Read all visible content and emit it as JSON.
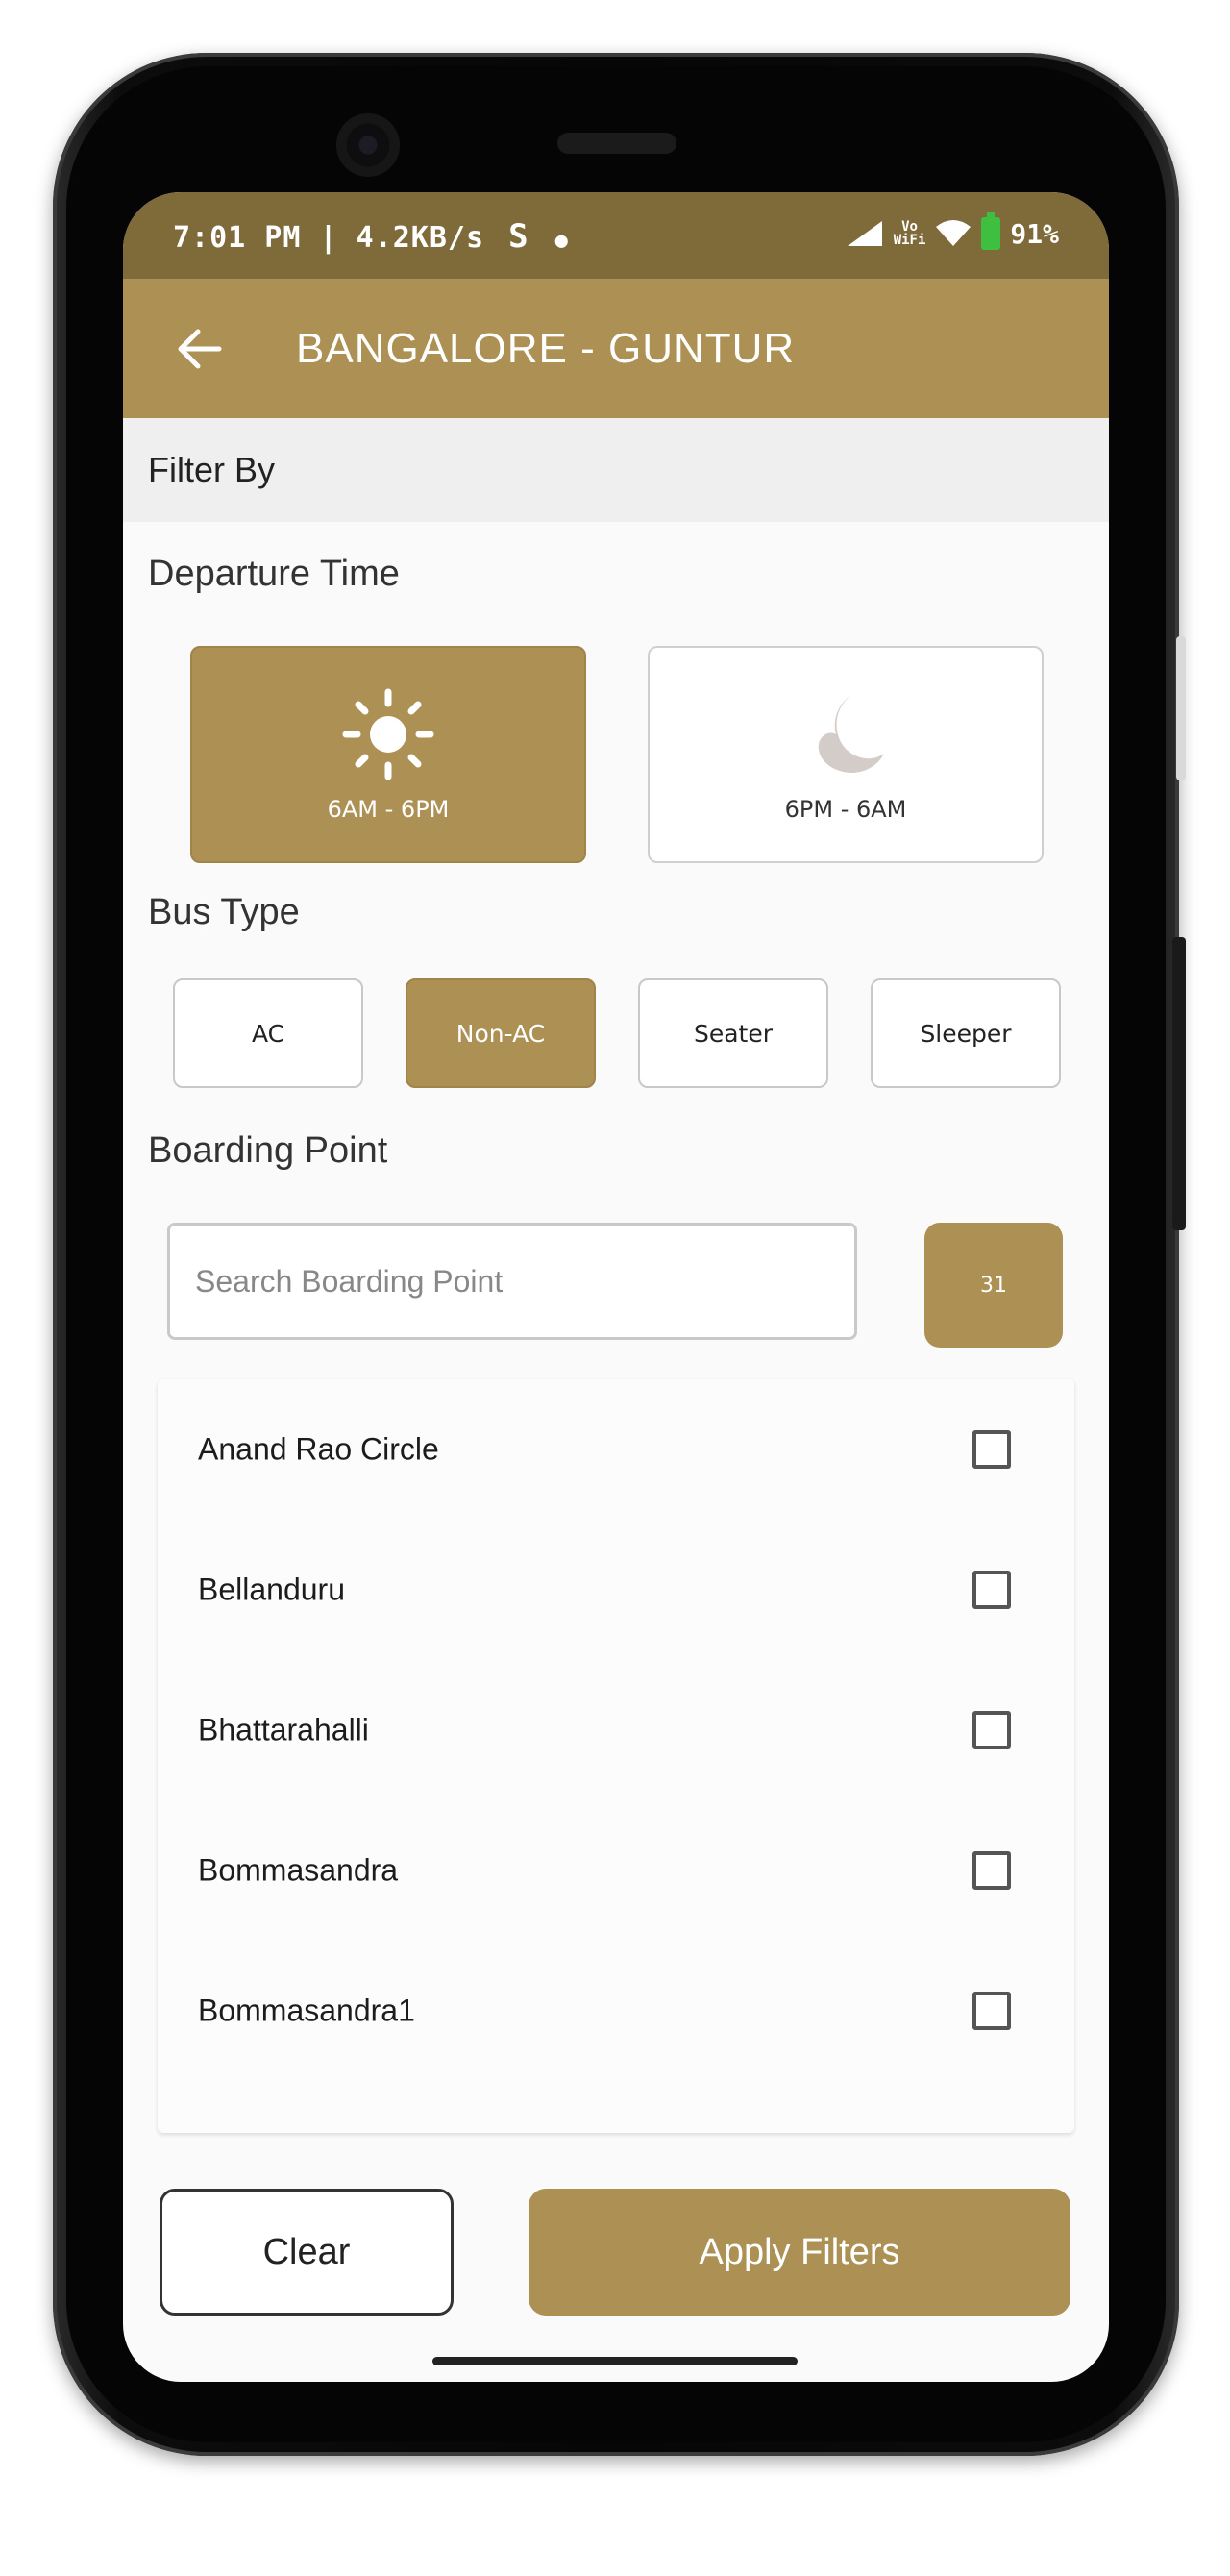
{
  "status_bar": {
    "time_speed": "7:01 PM | 4.2KB/s",
    "icons_left": [
      "s-icon",
      "notification-dot-icon"
    ],
    "vowifi": "Vo\nWiFi",
    "battery": "91%"
  },
  "app_bar": {
    "title": "BANGALORE - GUNTUR"
  },
  "filter_header": "Filter By",
  "departure": {
    "title": "Departure Time",
    "options": [
      {
        "label": "6AM - 6PM",
        "icon": "sun-icon",
        "selected": true
      },
      {
        "label": "6PM - 6AM",
        "icon": "moon-icon",
        "selected": false
      }
    ]
  },
  "bus_type": {
    "title": "Bus Type",
    "options": [
      {
        "label": "AC",
        "selected": false
      },
      {
        "label": "Non-AC",
        "selected": true
      },
      {
        "label": "Seater",
        "selected": false
      },
      {
        "label": "Sleeper",
        "selected": false
      }
    ]
  },
  "boarding": {
    "title": "Boarding Point",
    "search_placeholder": "Search Boarding Point",
    "count": "31",
    "points": [
      {
        "name": "Anand Rao Circle",
        "checked": false
      },
      {
        "name": "Bellanduru",
        "checked": false
      },
      {
        "name": "Bhattarahalli",
        "checked": false
      },
      {
        "name": "Bommasandra",
        "checked": false
      },
      {
        "name": "Bommasandra1",
        "checked": false
      }
    ]
  },
  "actions": {
    "clear": "Clear",
    "apply": "Apply Filters"
  },
  "colors": {
    "accent": "#ac9054",
    "status_bar": "#7f6a3a"
  }
}
